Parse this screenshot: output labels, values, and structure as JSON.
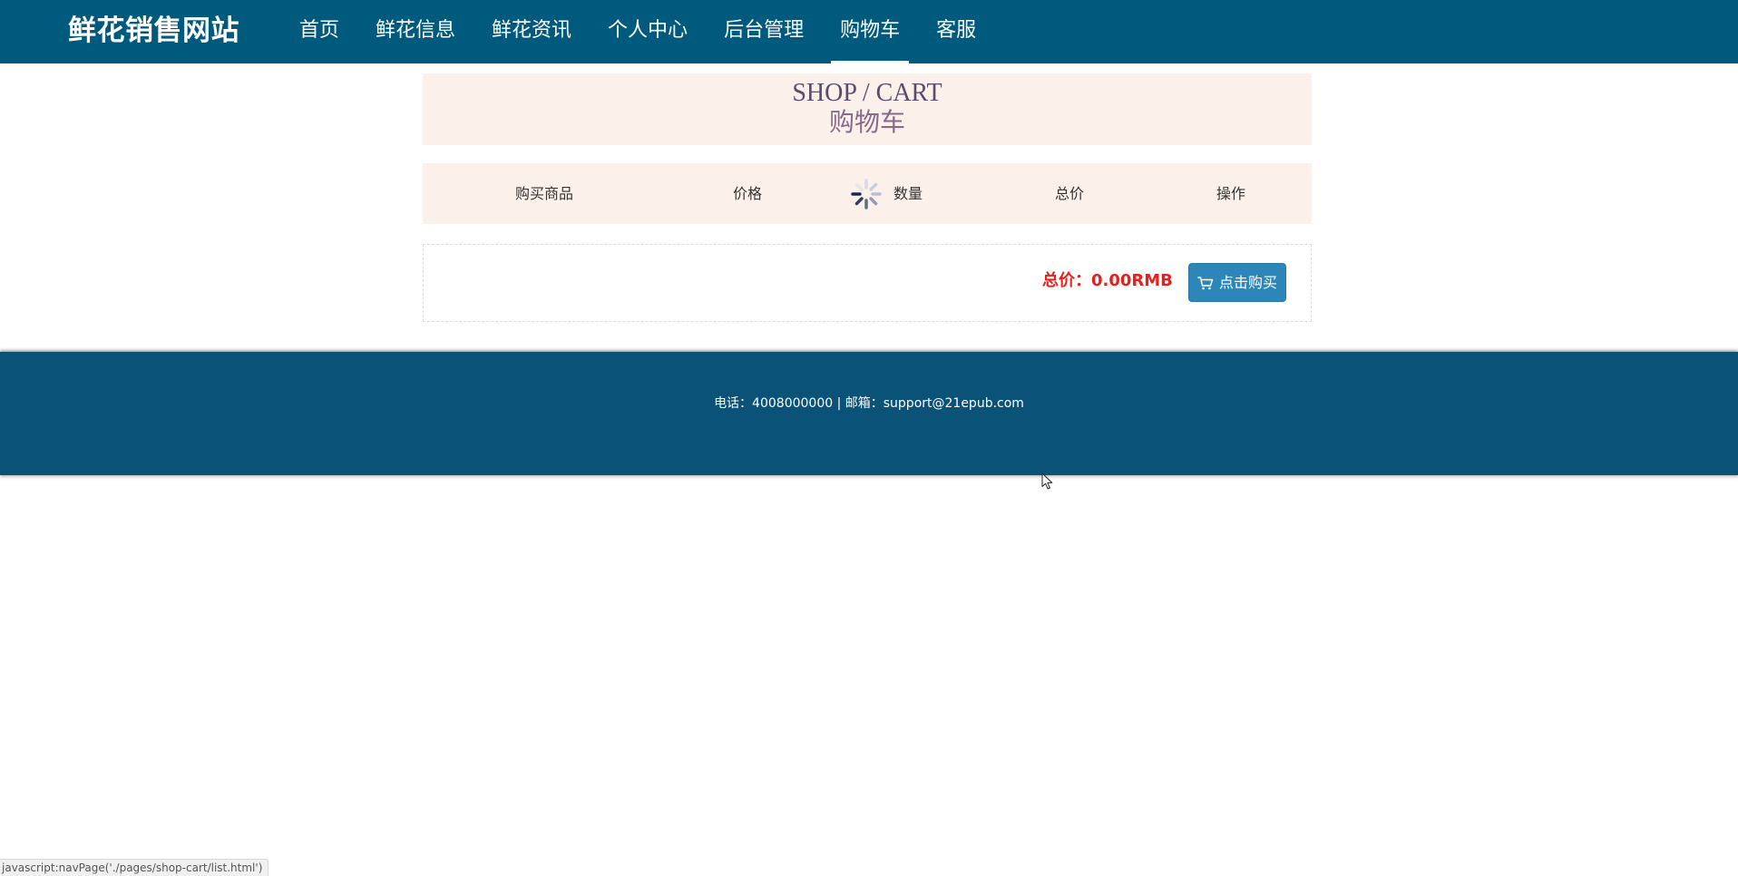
{
  "header": {
    "brand": "鲜花销售网站",
    "nav": [
      {
        "label": "首页"
      },
      {
        "label": "鲜花信息"
      },
      {
        "label": "鲜花资讯"
      },
      {
        "label": "个人中心"
      },
      {
        "label": "后台管理"
      },
      {
        "label": "购物车",
        "active": true
      },
      {
        "label": "客服"
      }
    ]
  },
  "title": {
    "en": "SHOP / CART",
    "cn": "购物车"
  },
  "table": {
    "columns": [
      "购买商品",
      "价格",
      "数量",
      "总价",
      "操作"
    ]
  },
  "cart": {
    "total_label": "总价：0.00RMB",
    "buy_label": "点击购买",
    "buy_icon": "cart-icon"
  },
  "footer": {
    "contact": "电话：4008000000 | 邮箱：support@21epub.com"
  },
  "status_bar": {
    "text": "javascript:navPage('./pages/shop-cart/list.html')"
  },
  "colors": {
    "header_bg": "#005a7d",
    "footer_bg": "#0b5279",
    "banner_bg": "#fbf0ea",
    "total_price": "#e8201c",
    "buy_button": "#2d86b8"
  },
  "loading_icon": "loading-spinner-icon"
}
